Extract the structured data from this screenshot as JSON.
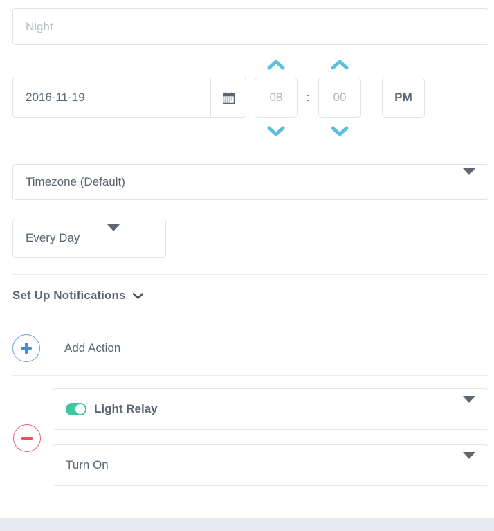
{
  "form": {
    "name_field": {
      "placeholder": "Night",
      "value": ""
    },
    "date_field": {
      "value": "2016-11-19",
      "calendar_icon": "calendar-icon"
    },
    "time": {
      "hour": "08",
      "minute": "00",
      "separator": ":",
      "meridian": "PM",
      "hour_up_icon": "chevron-up-icon",
      "hour_down_icon": "chevron-down-icon",
      "minute_up_icon": "chevron-up-icon",
      "minute_down_icon": "chevron-down-icon"
    },
    "timezone_select": {
      "value": "Timezone (Default)",
      "caret_icon": "caret-down-icon"
    },
    "repeat_select": {
      "value": "Every Day",
      "caret_icon": "caret-down-icon"
    },
    "notifications": {
      "label": "Set Up Notifications",
      "chevron_icon": "chevron-down-icon"
    },
    "add_action": {
      "label": "Add Action",
      "icon": "plus-icon"
    },
    "actions": [
      {
        "remove_icon": "minus-icon",
        "device": {
          "label": "Light Relay",
          "toggle_state": "on",
          "toggle_color": "#3ac9a0",
          "caret_icon": "caret-down-icon"
        },
        "command": {
          "label": "Turn On",
          "caret_icon": "caret-down-icon"
        }
      }
    ]
  },
  "colors": {
    "accent_blue": "#5bc0de",
    "add_blue": "#4a8bd8",
    "remove_red": "#e8525f",
    "toggle_green": "#3ac9a0",
    "text": "#5a6672",
    "placeholder": "#b4bcc4",
    "border": "#e0e3e8",
    "footer_band": "#e6e9ee"
  }
}
